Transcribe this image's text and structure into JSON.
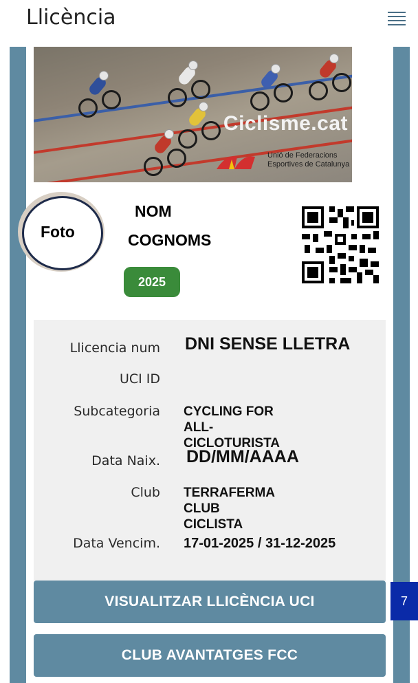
{
  "header": {
    "title": "Llicència",
    "menu_icon": "hamburger-icon"
  },
  "banner": {
    "brand": "Ciclisme.cat",
    "sub_line1": "Unió de Federacions",
    "sub_line2": "Esportives de Catalunya"
  },
  "profile": {
    "photo_label": "Foto",
    "first_name": "NOM",
    "last_name": "COGNOMS",
    "year": "2025",
    "qr_icon": "qr-code-icon"
  },
  "info": {
    "rows": [
      {
        "label": "Llicencia num",
        "value": "DNI SENSE LLETRA"
      },
      {
        "label": "UCI ID",
        "value": ""
      },
      {
        "label": "Subcategoria",
        "value_line1": "CYCLING FOR",
        "value_line2": "ALL-CICLOTURISTA"
      },
      {
        "label": "Data Naix.",
        "value": "DD/MM/AAAA"
      },
      {
        "label": "Club",
        "value_line1": "TERRAFERMA CLUB",
        "value_line2": "CICLISTA"
      },
      {
        "label": "Data Vencim.",
        "value": "17-01-2025 / 31-12-2025"
      }
    ]
  },
  "buttons": {
    "uci_license": "VISUALITZAR LLICÈNCIA UCI",
    "club_benefits": "CLUB AVANTATGES FCC"
  },
  "overlay_badge": "7",
  "colors": {
    "accent": "#5f8aa1",
    "year_badge": "#3a8b3a",
    "overlay": "#0a2aa8"
  }
}
